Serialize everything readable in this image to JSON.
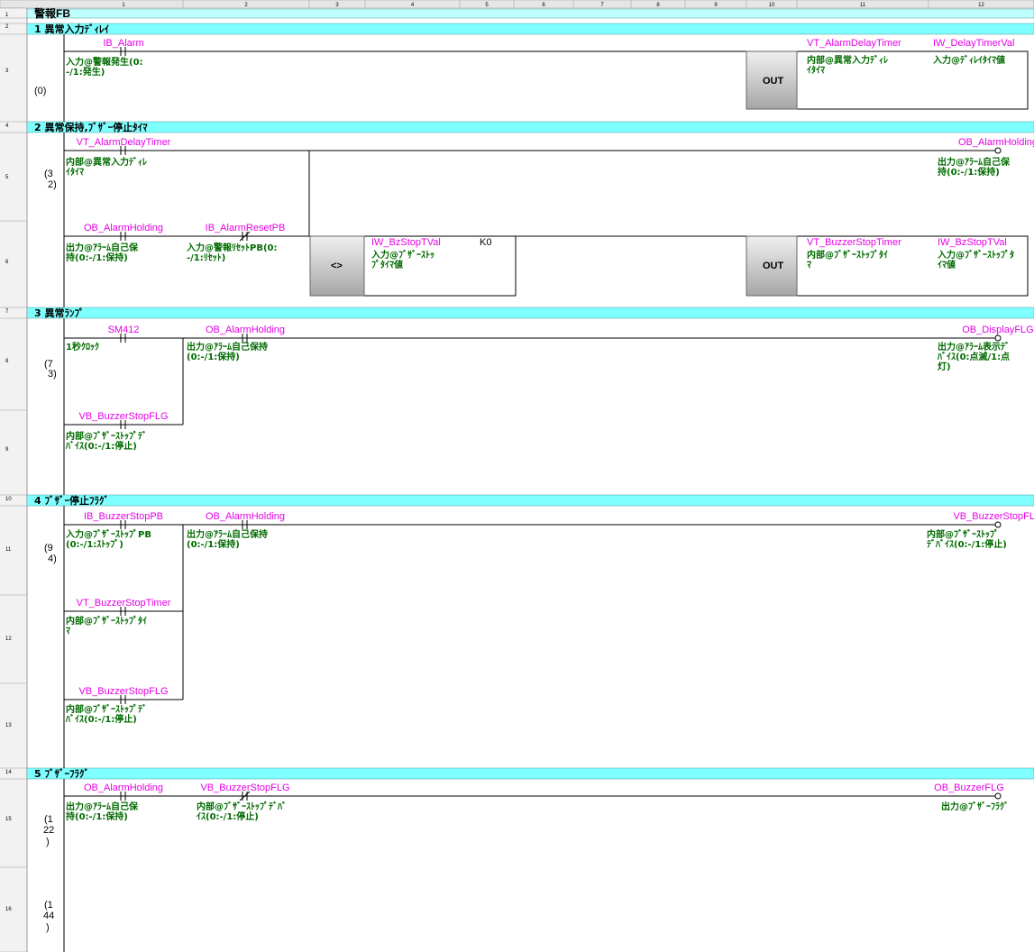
{
  "column_headers": [
    "1",
    "2",
    "3",
    "4",
    "5",
    "6",
    "7",
    "8",
    "9",
    "10",
    "11",
    "12"
  ],
  "fb_title": "警報FB",
  "sections": [
    "1 異常入力ﾃﾞｨﾚｲ",
    "2 異常保持,ﾌﾞｻﾞｰ停止ﾀｲﾏ",
    "3 異常ﾗﾝﾌﾟ",
    "4 ﾌﾞｻﾞｰ停止ﾌﾗｸﾞ",
    "5 ﾌﾞｻﾞｰﾌﾗｸﾞ"
  ],
  "row_numbers": [
    "1",
    "2",
    "3",
    "4",
    "5",
    "6",
    "7",
    "8",
    "9",
    "10",
    "11",
    "12",
    "13",
    "14",
    "15",
    "16"
  ],
  "step_numbers": [
    "(0)",
    "(3",
    "2)",
    "(7",
    "3)",
    "(9",
    "4)",
    "(1",
    "22",
    ")",
    "(1",
    "44",
    ")"
  ],
  "instructions": {
    "out": "OUT",
    "compare": "<>"
  },
  "constant_k0": "K0",
  "elements": [
    {
      "device": "IB_Alarm",
      "comment": [
        "入力@警報発生(0:",
        "-/1:発生)"
      ]
    },
    {
      "device": "VT_AlarmDelayTimer",
      "comment": [
        "内部@異常入力ﾃﾞｨﾚ",
        "ｲﾀｲﾏ"
      ]
    },
    {
      "device": "IW_DelayTimerVal",
      "comment": [
        "入力@ﾃﾞｨﾚｲﾀｲﾏ値"
      ]
    },
    {
      "device": "VT_AlarmDelayTimer",
      "comment": [
        "内部@異常入力ﾃﾞｨﾚ",
        "ｲﾀｲﾏ"
      ]
    },
    {
      "device": "OB_AlarmHolding",
      "comment": [
        "出力@ｱﾗｰﾑ自己保",
        "持(0:-/1:保持)"
      ]
    },
    {
      "device": "OB_AlarmHolding",
      "comment": [
        "出力@ｱﾗｰﾑ自己保",
        "持(0:-/1:保持)"
      ]
    },
    {
      "device": "IB_AlarmResetPB",
      "comment": [
        "入力@警報ﾘｾｯﾄPB(0:",
        "-/1:ﾘｾｯﾄ)"
      ]
    },
    {
      "device": "IW_BzStopTVal",
      "comment": [
        "入力@ﾌﾞｻﾞｰｽﾄｯ",
        "ﾌﾟﾀｲﾏ値"
      ]
    },
    {
      "device": "VT_BuzzerStopTimer",
      "comment": [
        "内部@ﾌﾞｻﾞｰｽﾄｯﾌﾟﾀｲ",
        "ﾏ"
      ]
    },
    {
      "device": "IW_BzStopTVal",
      "comment": [
        "入力@ﾌﾞｻﾞｰｽﾄｯﾌﾟﾀ",
        "ｲﾏ値"
      ]
    },
    {
      "device": "SM412",
      "comment": [
        "1秒ｸﾛｯｸ"
      ]
    },
    {
      "device": "OB_AlarmHolding",
      "comment": [
        "出力@ｱﾗｰﾑ自己保持",
        "(0:-/1:保持)"
      ]
    },
    {
      "device": "OB_DisplayFLG",
      "comment": [
        "出力@ｱﾗｰﾑ表示ﾃﾞ",
        "ﾊﾞｲｽ(0:点滅/1:点",
        "灯)"
      ]
    },
    {
      "device": "VB_BuzzerStopFLG",
      "comment": [
        "内部@ﾌﾞｻﾞｰｽﾄｯﾌﾟﾃﾞ",
        "ﾊﾞｲｽ(0:-/1:停止)"
      ]
    },
    {
      "device": "IB_BuzzerStopPB",
      "comment": [
        "入力@ﾌﾞｻﾞｰｽﾄｯﾌﾟPB",
        "(0:-/1:ｽﾄｯﾌﾟ)"
      ]
    },
    {
      "device": "OB_AlarmHolding",
      "comment": [
        "出力@ｱﾗｰﾑ自己保持",
        "(0:-/1:保持)"
      ]
    },
    {
      "device": "VB_BuzzerStopFLG",
      "comment": [
        "内部@ﾌﾞｻﾞｰｽﾄｯﾌﾟ",
        "ﾃﾞﾊﾞｲｽ(0:-/1:停止)"
      ]
    },
    {
      "device": "VT_BuzzerStopTimer",
      "comment": [
        "内部@ﾌﾞｻﾞｰｽﾄｯﾌﾟﾀｲ",
        "ﾏ"
      ]
    },
    {
      "device": "VB_BuzzerStopFLG",
      "comment": [
        "内部@ﾌﾞｻﾞｰｽﾄｯﾌﾟﾃﾞ",
        "ﾊﾞｲｽ(0:-/1:停止)"
      ]
    },
    {
      "device": "OB_AlarmHolding",
      "comment": [
        "出力@ｱﾗｰﾑ自己保",
        "持(0:-/1:保持)"
      ]
    },
    {
      "device": "VB_BuzzerStopFLG",
      "comment": [
        "内部@ﾌﾞｻﾞｰｽﾄｯﾌﾟﾃﾞﾊﾞ",
        "ｲｽ(0:-/1:停止)"
      ]
    },
    {
      "device": "OB_BuzzerFLG",
      "comment": [
        "出力@ﾌﾞｻﾞｰﾌﾗｸﾞ"
      ]
    }
  ],
  "colors": {
    "section_bar": "#7fffff",
    "device_label": "#e600e6",
    "comment_text": "#006b00",
    "header_bg": "#e6e6e6"
  }
}
